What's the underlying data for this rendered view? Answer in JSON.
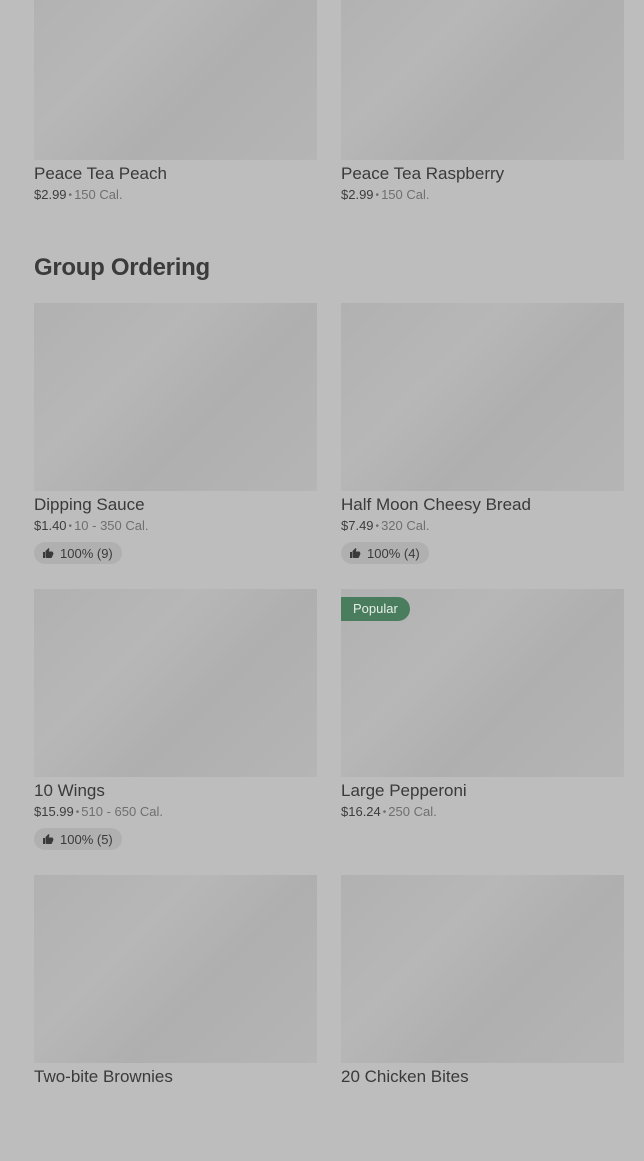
{
  "top_items": [
    {
      "name": "Peace Tea Peach",
      "price": "$2.99",
      "calories": "150 Cal."
    },
    {
      "name": "Peace Tea Raspberry",
      "price": "$2.99",
      "calories": "150 Cal."
    }
  ],
  "section": {
    "title": "Group Ordering"
  },
  "items": [
    {
      "name": "Dipping Sauce",
      "price": "$1.40",
      "calories": "10 - 350 Cal.",
      "rating": "100% (9)"
    },
    {
      "name": "Half Moon Cheesy Bread",
      "price": "$7.49",
      "calories": "320 Cal.",
      "rating": "100% (4)"
    },
    {
      "name": "10 Wings",
      "price": "$15.99",
      "calories": "510 - 650 Cal.",
      "rating": "100% (5)"
    },
    {
      "name": "Large Pepperoni",
      "price": "$16.24",
      "calories": "250 Cal.",
      "badge": "Popular"
    },
    {
      "name": "Two-bite Brownies"
    },
    {
      "name": "20 Chicken Bites"
    }
  ],
  "icons": {
    "rating": "thumbs-up-icon"
  },
  "colors": {
    "badge": "#4a7d5d",
    "background": "#bdbdbd"
  }
}
